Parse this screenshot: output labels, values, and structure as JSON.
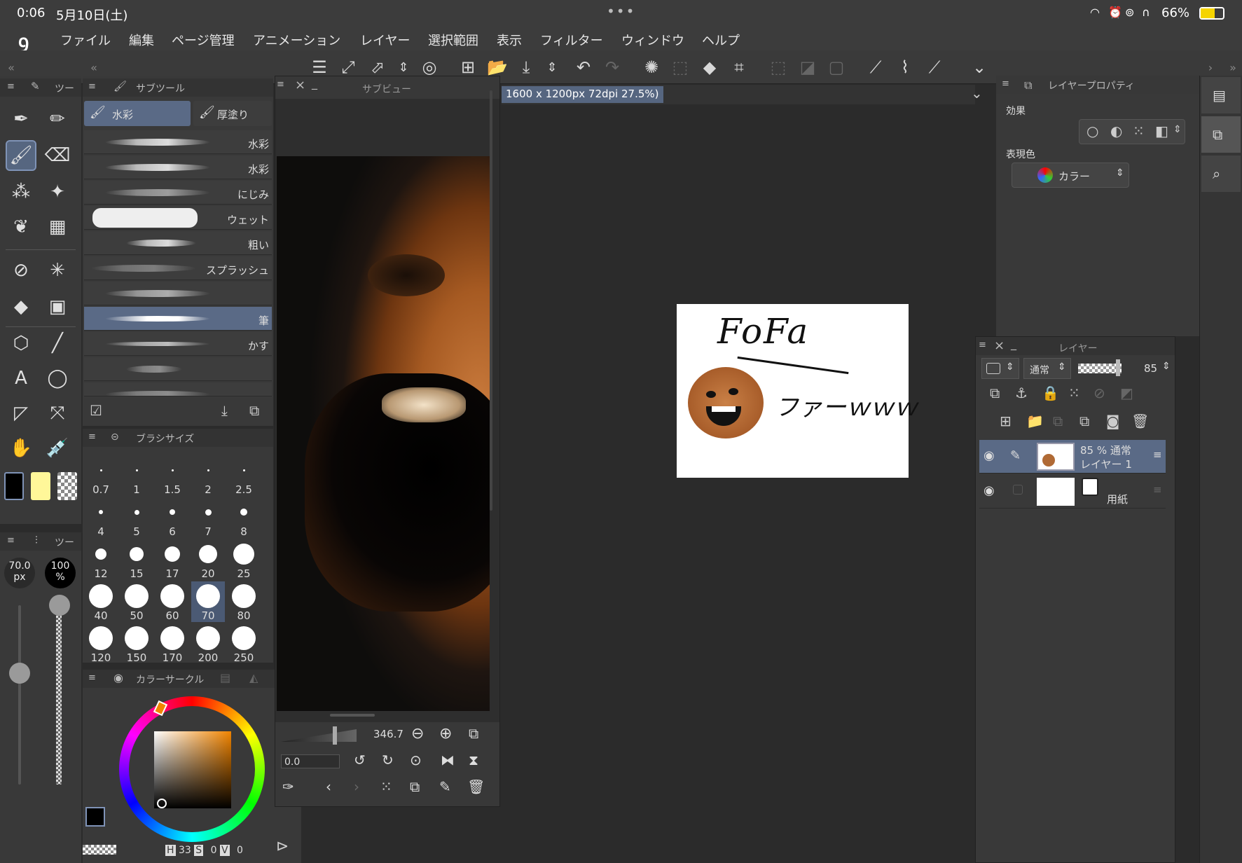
{
  "status": {
    "time": "0:06",
    "date": "5月10日(土)",
    "battery": "66%",
    "dots": "•••"
  },
  "menu": [
    "ファイル",
    "編集",
    "ページ管理",
    "アニメーション",
    "レイヤー",
    "選択範囲",
    "表示",
    "フィルター",
    "ウィンドウ",
    "ヘルプ"
  ],
  "tool_panel": {
    "title": "ツー"
  },
  "subtool": {
    "title": "サブツール",
    "tabs": [
      "水彩",
      "厚塗り"
    ],
    "brushes": [
      "水彩",
      "水彩",
      "にじみ",
      "ウェット",
      "粗い",
      "スプラッシュ",
      "",
      "筆",
      "かす",
      ""
    ]
  },
  "brush_size": {
    "title": "ブラシサイズ",
    "sizes": [
      "0.7",
      "1",
      "1.5",
      "2",
      "2.5",
      "4",
      "5",
      "6",
      "7",
      "8",
      "12",
      "15",
      "17",
      "20",
      "25",
      "40",
      "50",
      "60",
      "70",
      "80",
      "120",
      "150",
      "170",
      "200",
      "250"
    ],
    "selected": "70"
  },
  "tool_property": {
    "title": "ツー",
    "size_value": "70.0",
    "size_unit": "px",
    "opacity_value": "100",
    "opacity_unit": "%"
  },
  "color_circle": {
    "title": "カラーサークル",
    "h_label": "H",
    "h": "33",
    "s_label": "S",
    "s": "0",
    "v_label": "V",
    "v": "0",
    "main_color": "#000000",
    "sub_color": "#fff799"
  },
  "subview": {
    "title": "サブビュー",
    "zoom": "346.7",
    "angle": "0.0"
  },
  "canvas": {
    "info": "1600 x 1200px 72dpi 27.5%)",
    "drawing_text": "FoFa",
    "drawing_text2": "ファーｗｗｗ"
  },
  "layer_property": {
    "title": "レイヤープロパティ",
    "effect_label": "効果",
    "expression_label": "表現色",
    "expression_value": "カラー"
  },
  "layers": {
    "title": "レイヤー",
    "blend": "通常",
    "opacity": "85",
    "items": [
      {
        "info": "85 % 通常",
        "name": "レイヤー 1"
      },
      {
        "info": "",
        "name": "用紙"
      }
    ]
  }
}
